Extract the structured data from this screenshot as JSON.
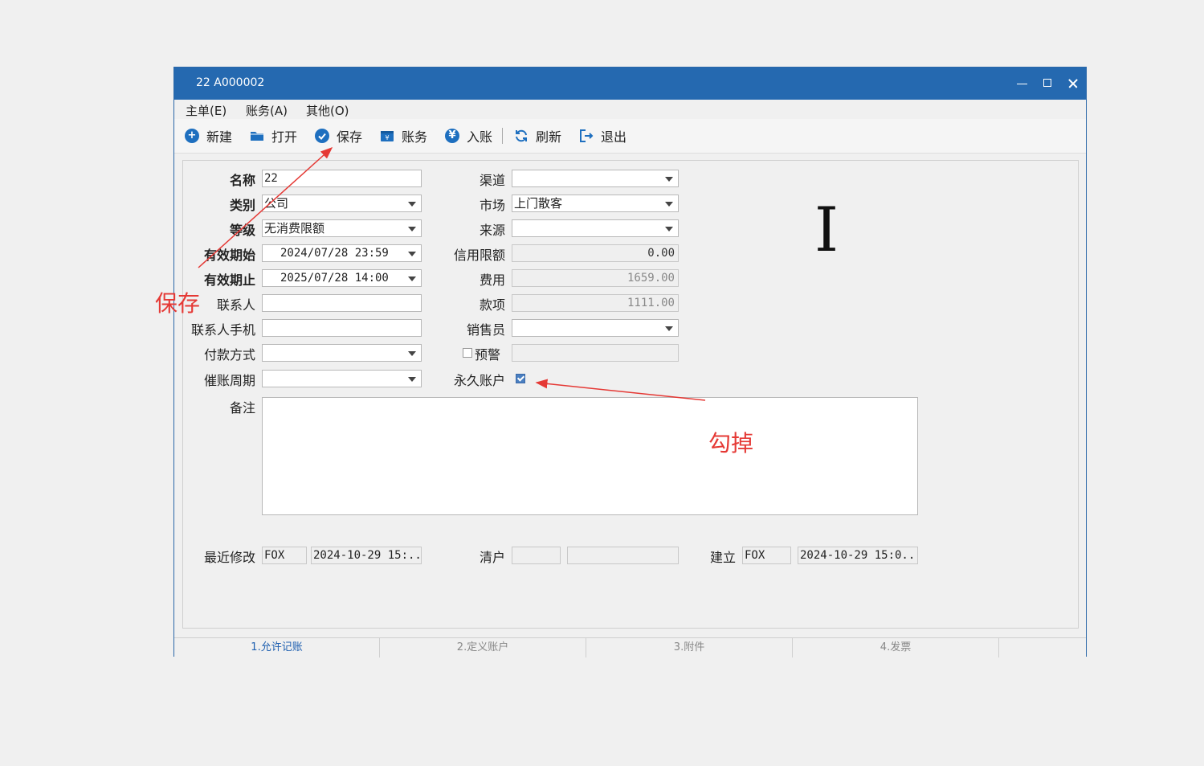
{
  "window": {
    "title": "22  A000002"
  },
  "menu": [
    "主单(E)",
    "账务(A)",
    "其他(O)"
  ],
  "toolbar": {
    "new": "新建",
    "open": "打开",
    "save": "保存",
    "accounts": "账务",
    "post": "入账",
    "refresh": "刷新",
    "exit": "退出"
  },
  "form": {
    "name_label": "名称",
    "name_value": "22",
    "category_label": "类别",
    "category_value": "公司",
    "level_label": "等级",
    "level_value": "无消费限额",
    "valid_from_label": "有效期始",
    "valid_from_value": "2024/07/28 23:59",
    "valid_to_label": "有效期止",
    "valid_to_value": "2025/07/28 14:00",
    "contact_label": "联系人",
    "contact_value": "",
    "contact_phone_label": "联系人手机",
    "contact_phone_value": "",
    "payment_label": "付款方式",
    "payment_value": "",
    "dunning_label": "催账周期",
    "dunning_value": "",
    "channel_label": "渠道",
    "channel_value": "",
    "market_label": "市场",
    "market_value": "上门散客",
    "source_label": "来源",
    "source_value": "",
    "credit_label": "信用限额",
    "credit_value": "0.00",
    "fee_label": "费用",
    "fee_value": "1659.00",
    "payment_amount_label": "款项",
    "payment_amount_value": "1111.00",
    "sales_label": "销售员",
    "sales_value": "",
    "alert_label": "预警",
    "alert_checked": false,
    "alert_value": "",
    "permanent_label": "永久账户",
    "permanent_checked": true,
    "remarks_label": "备注",
    "remarks_value": "",
    "last_modified_label": "最近修改",
    "last_modified_user": "FOX",
    "last_modified_time": "2024-10-29 15:...",
    "clear_label": "清户",
    "clear_user": "",
    "clear_time": "",
    "created_label": "建立",
    "created_user": "FOX",
    "created_time": "2024-10-29 15:0..."
  },
  "cursor_glyph": "I",
  "tabs": [
    "1.允许记账",
    "2.定义账户",
    "3.附件",
    "4.发票"
  ],
  "annotations": {
    "save_note": "保存",
    "uncheck_note": "勾掉",
    "color": "#e53935"
  },
  "colors": {
    "titlebar": "#2569b0",
    "icon": "#1e6fbf",
    "active_tab": "#1e5fb0"
  }
}
